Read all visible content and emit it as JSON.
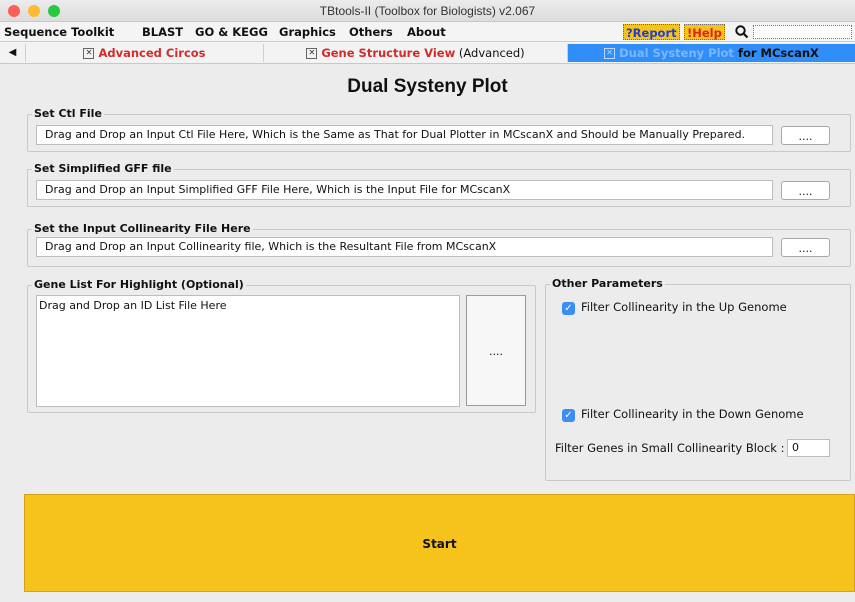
{
  "window": {
    "title": "TBtools-II (Toolbox for Biologists) v2.067"
  },
  "menu": {
    "items": [
      "Sequence Toolkit",
      "BLAST",
      "GO & KEGG",
      "Graphics",
      "Others",
      "About"
    ],
    "report": "?Report",
    "help": "!Help"
  },
  "tabs": {
    "back_arrow": "◀",
    "items": [
      {
        "label_red": "Advanced Circos",
        "label_rest": ""
      },
      {
        "label_red": "Gene Structure View",
        "label_rest": " (Advanced)"
      },
      {
        "label_red": "Dual Systeny Plot",
        "label_rest": " for MCscanX"
      }
    ]
  },
  "page_title": "Dual Systeny Plot",
  "ctl": {
    "legend": "Set Ctl File",
    "placeholder": "Drag and Drop an Input Ctl File Here, Which is the Same as That for Dual Plotter in MCscanX and Should be Manually Prepared.",
    "button": "...."
  },
  "gff": {
    "legend": "Set Simplified GFF file",
    "placeholder": "Drag and Drop an Input Simplified GFF File Here, Which is the Input File for MCscanX",
    "button": "...."
  },
  "collinearity": {
    "legend": "Set the Input Collinearity File Here",
    "placeholder": "Drag and Drop an Input Collinearity file, Which is the Resultant File from MCscanX",
    "button": "...."
  },
  "gene_list": {
    "legend": "Gene List For Highlight (Optional)",
    "placeholder": "Drag and Drop an ID List File Here",
    "button": "...."
  },
  "params": {
    "legend": "Other Parameters",
    "filter_up": {
      "label": "Filter Collinearity in the Up Genome",
      "checked": true
    },
    "filter_down": {
      "label": "Filter Collinearity in the Down Genome",
      "checked": true
    },
    "small_block": {
      "label": "Filter Genes in Small Collinearity Block :",
      "value": "0"
    }
  },
  "start_button": "Start",
  "colors": {
    "accent_yellow": "#f6c21c",
    "tab_active": "#2f8ef7",
    "tab_red": "#d22b2b",
    "check_blue": "#3b8ef3"
  },
  "icons": {
    "search": "search-icon",
    "check": "checkmark-icon",
    "close_tab": "close-box-icon",
    "back": "left-arrow-icon"
  }
}
